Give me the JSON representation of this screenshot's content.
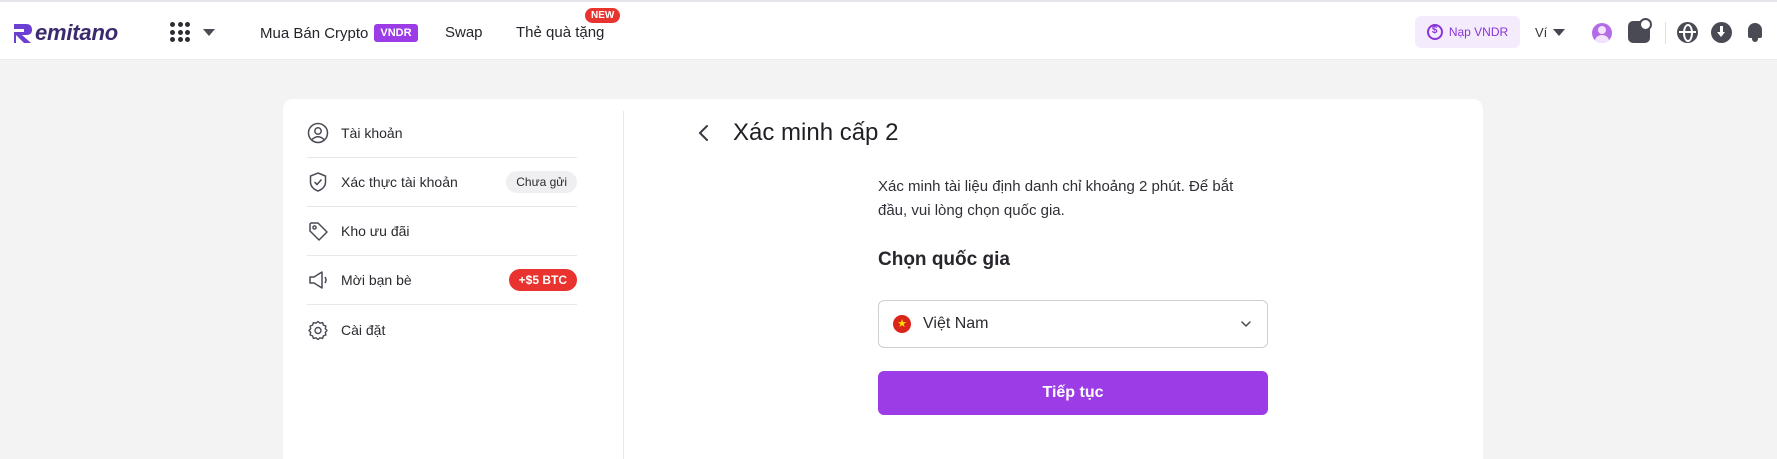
{
  "brand": {
    "name": "Remitano",
    "accent": "#9b3ce6"
  },
  "nav": {
    "buy_sell": "Mua Bán Crypto",
    "vndr_badge": "VNDR",
    "swap": "Swap",
    "gift_card": "Thẻ quà tặng",
    "new_badge": "NEW",
    "deposit": "Nạp VNDR",
    "wallet": "Ví"
  },
  "sidebar": {
    "items": [
      {
        "label": "Tài khoản",
        "icon": "user-icon"
      },
      {
        "label": "Xác thực tài khoản",
        "icon": "shield-check-icon",
        "badge": "Chưa gửi"
      },
      {
        "label": "Kho ưu đãi",
        "icon": "tag-icon"
      },
      {
        "label": "Mời bạn bè",
        "icon": "megaphone-icon",
        "badge": "+$5 BTC"
      },
      {
        "label": "Cài đặt",
        "icon": "gear-icon"
      }
    ]
  },
  "main": {
    "title": "Xác minh cấp 2",
    "description": "Xác minh tài liệu định danh chỉ khoảng 2 phút. Để bắt đầu, vui lòng chọn quốc gia.",
    "country_label": "Chọn quốc gia",
    "country_value": "Việt Nam",
    "continue_label": "Tiếp tục"
  }
}
